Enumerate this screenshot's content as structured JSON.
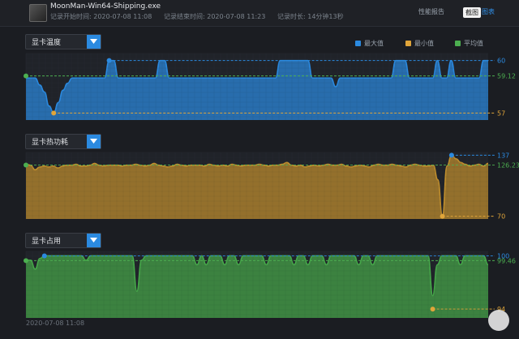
{
  "header": {
    "exe_name": "MoonMan-Win64-Shipping.exe",
    "start_time": "记录开始时间: 2020-07-08 11:08",
    "end_time": "记录结束时间: 2020-07-08 11:23",
    "duration": "记录时长: 14分钟13秒",
    "tabs": [
      "性能报告",
      "截图",
      "图表"
    ]
  },
  "legend": {
    "max_label": "最大值",
    "min_label": "最小值",
    "avg_label": "平均值",
    "colors": {
      "max": "#2b8ae0",
      "min": "#e0a53a",
      "avg": "#4caf50"
    }
  },
  "footer": {
    "timestamp": "2020-07-08 11:08"
  },
  "chart_data": [
    {
      "type": "area",
      "title": "显卡温度",
      "color": "#2b8ae0",
      "ylim": [
        56.6,
        60.4
      ],
      "max_value": 60,
      "min_value": 57,
      "avg_value": 59.12,
      "labels": {
        "max": "60",
        "min": "57",
        "avg": "59.12"
      },
      "values": [
        59,
        59,
        59,
        58.6,
        58.2,
        57.4,
        57,
        57.6,
        58.3,
        58.7,
        59,
        59,
        59,
        59,
        59,
        59,
        59,
        59,
        60,
        60,
        59,
        59,
        59,
        59,
        59,
        59,
        59,
        59,
        59,
        60,
        60,
        59,
        59,
        59,
        59,
        59,
        59,
        59,
        59,
        59,
        59,
        59,
        59,
        59,
        59,
        59,
        59,
        59,
        59,
        59,
        59,
        59,
        59,
        59,
        59,
        60,
        60,
        60,
        60,
        60,
        60,
        60,
        59,
        59,
        59,
        59,
        59,
        58.5,
        59,
        59,
        59,
        59,
        59,
        59,
        59,
        59,
        59,
        59,
        59,
        59,
        60,
        60,
        60,
        59,
        59,
        59,
        59,
        59,
        59,
        60,
        59,
        59,
        60,
        59,
        59,
        59,
        59,
        59,
        59,
        60,
        60
      ]
    },
    {
      "type": "area",
      "title": "显卡热功耗",
      "color": "#c08f2e",
      "ylim": [
        67,
        140
      ],
      "max_value": 137,
      "min_value": 70,
      "avg_value": 126.23,
      "labels": {
        "max": "137",
        "min": "70",
        "avg": "126.23"
      },
      "values": [
        127,
        126,
        121,
        124,
        125,
        124,
        125,
        123,
        125,
        126,
        126,
        127,
        125,
        125,
        126,
        128,
        126,
        125,
        126,
        126,
        126,
        125,
        126,
        126,
        127,
        126,
        125,
        126,
        128,
        126,
        125,
        124,
        125,
        127,
        126,
        125,
        126,
        126,
        126,
        125,
        127,
        126,
        125,
        126,
        125,
        127,
        126,
        125,
        126,
        126,
        126,
        127,
        126,
        125,
        126,
        126,
        127,
        129,
        126,
        125,
        126,
        124,
        125,
        126,
        125,
        126,
        127,
        126,
        126,
        127,
        125,
        124,
        125,
        126,
        125,
        124,
        126,
        127,
        126,
        126,
        127,
        126,
        125,
        124,
        126,
        127,
        126,
        125,
        125,
        126,
        110,
        70,
        125,
        137,
        133,
        129,
        127,
        125,
        126,
        127,
        125,
        128
      ]
    },
    {
      "type": "area",
      "title": "显卡占用",
      "color": "#46a84a",
      "ylim": [
        93,
        100.5
      ],
      "max_value": 100,
      "min_value": 94,
      "avg_value": 99.46,
      "labels": {
        "max": "100",
        "min": "94",
        "avg": "99.46"
      },
      "values": [
        99.5,
        99.5,
        98.5,
        99.7,
        100,
        100,
        100,
        100,
        100,
        100,
        100,
        100,
        100,
        99.5,
        100,
        100,
        100,
        100,
        100,
        100,
        100,
        100,
        100,
        100,
        96,
        99.5,
        100,
        100,
        100,
        100,
        100,
        100,
        100,
        100,
        100,
        100,
        100,
        99,
        100,
        99,
        100,
        100,
        100,
        99,
        100,
        100,
        99,
        100,
        100,
        100,
        100,
        100,
        99,
        100,
        100,
        100,
        100,
        100,
        99,
        100,
        100,
        99,
        100,
        100,
        100,
        99,
        100,
        100,
        100,
        100,
        100,
        100,
        99,
        100,
        100,
        99,
        100,
        100,
        100,
        100,
        100,
        100,
        100,
        100,
        100,
        100,
        100,
        100,
        95.5,
        99,
        100,
        100,
        100,
        100,
        99,
        100,
        100,
        100,
        100,
        100,
        99
      ]
    }
  ]
}
